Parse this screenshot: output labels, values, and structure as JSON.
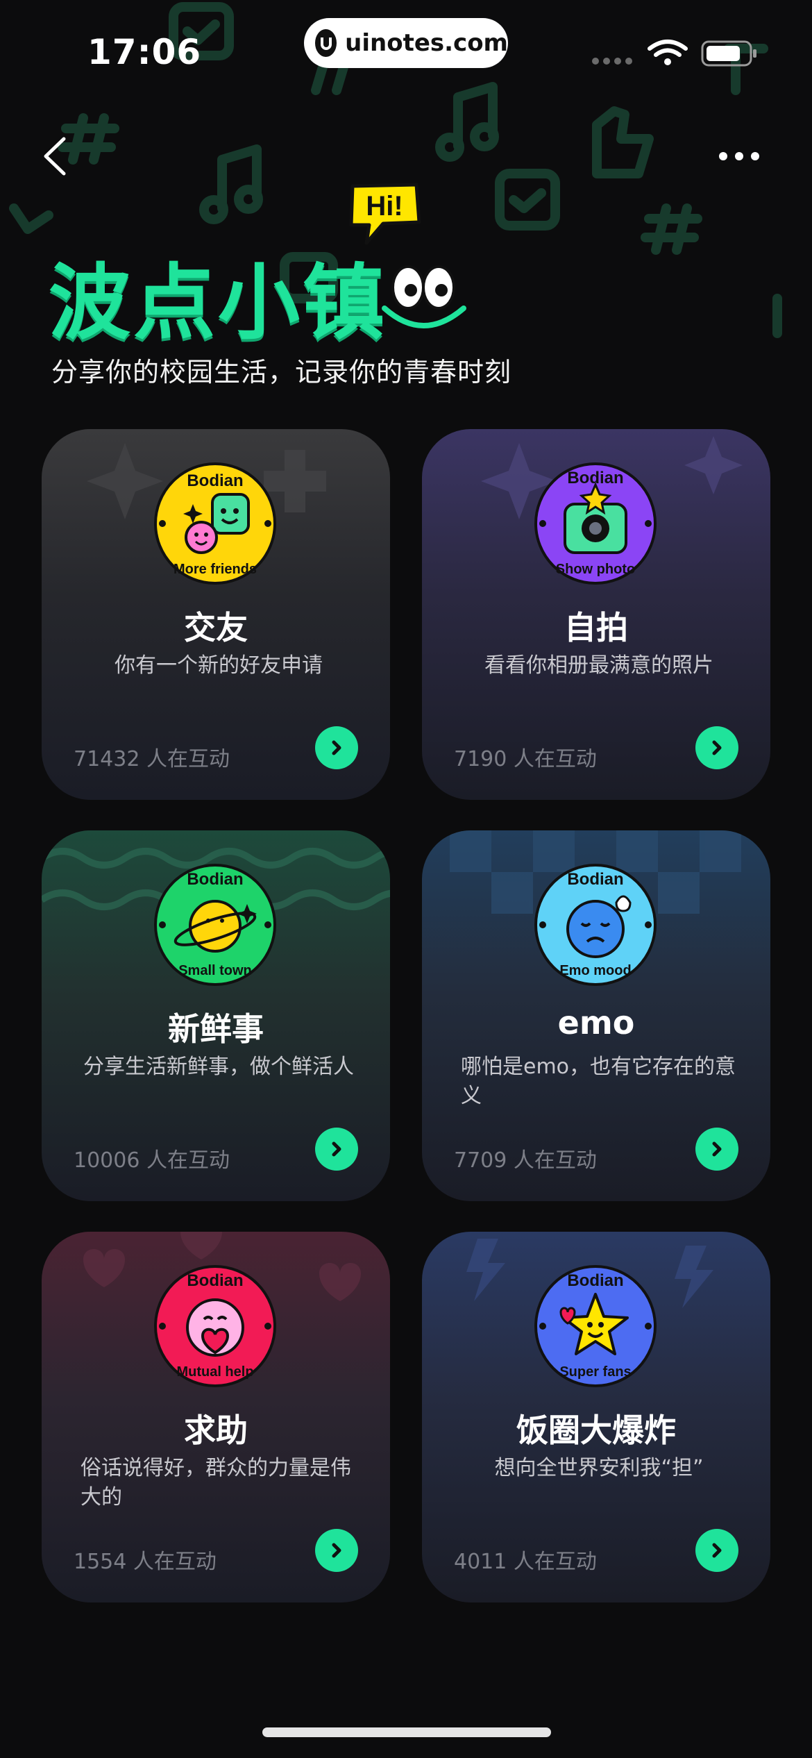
{
  "status_bar": {
    "time": "17:06",
    "url": "uinotes.com"
  },
  "nav": {
    "back_icon": "chevron-left-icon",
    "more_icon": "ellipsis-icon"
  },
  "hero": {
    "title": "波点小镇",
    "bubble": "Hi!",
    "subtitle": "分享你的校园生活，记录你的青春时刻"
  },
  "colors": {
    "accent": "#1fe39b",
    "background": "#0c0c0d"
  },
  "cards": [
    {
      "title": "交友",
      "desc": "你有一个新的好友申请",
      "count": "71432 人在互动",
      "badge_top": "Bodian",
      "badge_bottom": "More friends",
      "badge_color": "#ffd60a"
    },
    {
      "title": "自拍",
      "desc": "看看你相册最满意的照片",
      "count": "7190 人在互动",
      "badge_top": "Bodian",
      "badge_bottom": "Show photo",
      "badge_color": "#8b45f5"
    },
    {
      "title": "新鲜事",
      "desc": "分享生活新鲜事，做个鲜活人",
      "count": "10006 人在互动",
      "badge_top": "Bodian",
      "badge_bottom": "Small town",
      "badge_color": "#1ed36a"
    },
    {
      "title": "emo",
      "desc": "哪怕是emo，也有它存在的意义",
      "count": "7709 人在互动",
      "badge_top": "Bodian",
      "badge_bottom": "Emo mood",
      "badge_color": "#5fd2f7"
    },
    {
      "title": "求助",
      "desc": "俗话说得好，群众的力量是伟大的",
      "count": "1554 人在互动",
      "badge_top": "Bodian",
      "badge_bottom": "Mutual help",
      "badge_color": "#f21b55"
    },
    {
      "title": "饭圈大爆炸",
      "desc": "想向全世界安利我“担”",
      "count": "4011 人在互动",
      "badge_top": "Bodian",
      "badge_bottom": "Super fans",
      "badge_color": "#4d6cf2"
    }
  ]
}
